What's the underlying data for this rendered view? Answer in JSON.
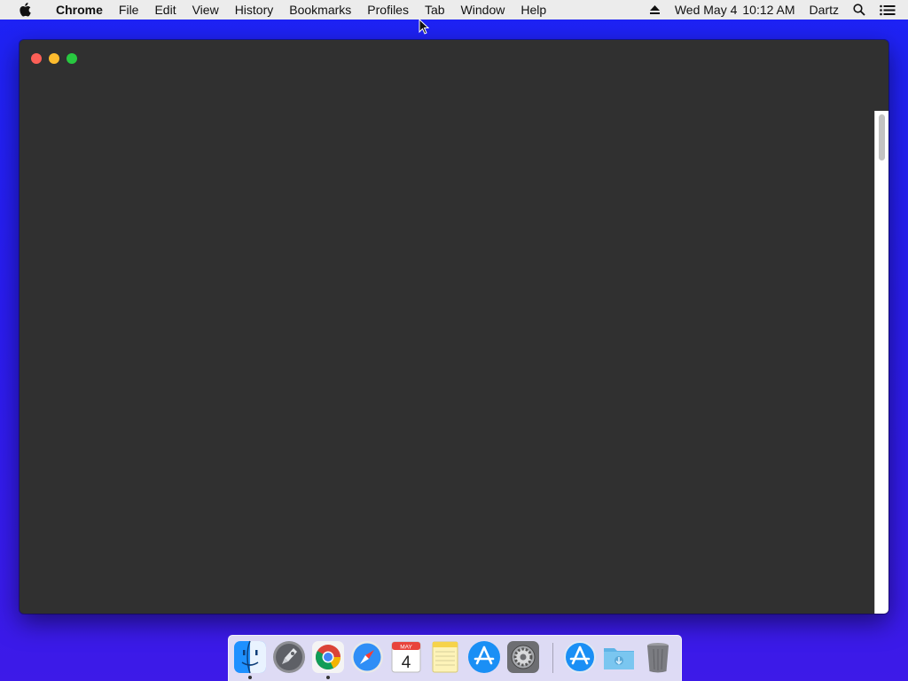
{
  "menubar": {
    "app_name": "Chrome",
    "items": [
      "File",
      "Edit",
      "View",
      "History",
      "Bookmarks",
      "Profiles",
      "Tab",
      "Window",
      "Help"
    ],
    "status": {
      "eject_icon": "eject-icon",
      "datetime_day": "Wed May 4",
      "datetime_time": "10:12 AM",
      "user": "Dartz",
      "search_icon": "spotlight-search-icon",
      "notification_icon": "notification-center-icon"
    }
  },
  "window": {
    "background": "#303030",
    "controls": [
      "close",
      "minimize",
      "zoom"
    ]
  },
  "dock": {
    "apps": [
      {
        "name": "Finder",
        "icon": "finder-icon",
        "running": true
      },
      {
        "name": "Launchpad",
        "icon": "launchpad-icon",
        "running": false
      },
      {
        "name": "Google Chrome",
        "icon": "chrome-icon",
        "running": true
      },
      {
        "name": "Safari",
        "icon": "safari-icon",
        "running": false
      },
      {
        "name": "Calendar",
        "icon": "calendar-icon",
        "running": false,
        "month": "MAY",
        "day": "4"
      },
      {
        "name": "Notes",
        "icon": "notes-icon",
        "running": false
      },
      {
        "name": "App Store",
        "icon": "app-store-icon",
        "running": false
      },
      {
        "name": "System Preferences",
        "icon": "system-preferences-icon",
        "running": false
      }
    ],
    "stacks": [
      {
        "name": "Applications",
        "icon": "applications-folder-icon"
      },
      {
        "name": "Downloads",
        "icon": "downloads-folder-icon"
      },
      {
        "name": "Trash",
        "icon": "trash-icon"
      }
    ]
  },
  "colors": {
    "desktop": "#2a1cf0",
    "menubar": "#ececec",
    "window": "#303030",
    "close": "#fc5f57",
    "minimize": "#fdbc2e",
    "zoom": "#28c840"
  }
}
